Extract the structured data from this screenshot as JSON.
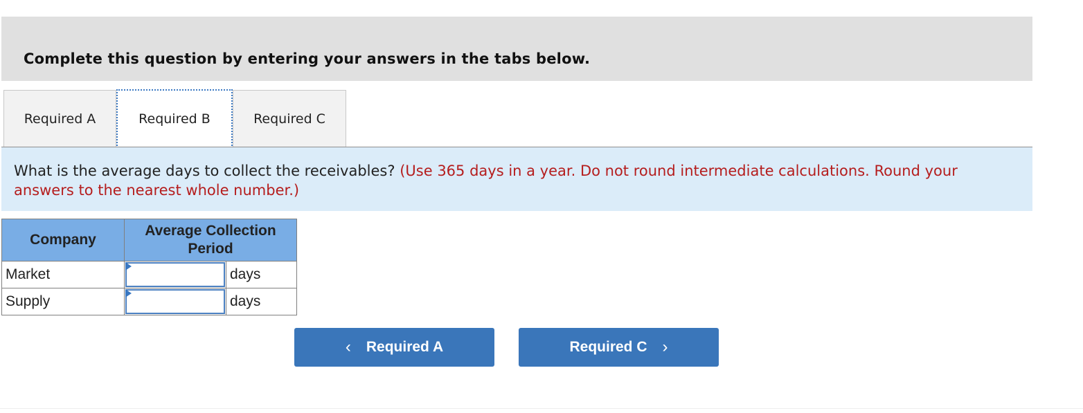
{
  "instruction": "Complete this question by entering your answers in the tabs below.",
  "tabs": [
    {
      "label": "Required A",
      "active": false
    },
    {
      "label": "Required B",
      "active": true
    },
    {
      "label": "Required C",
      "active": false
    }
  ],
  "question": {
    "text": "What is the average days to collect the receivables?",
    "note": "(Use 365 days in a year. Do not round intermediate calculations. Round your answers to the nearest whole number.)"
  },
  "table": {
    "headers": [
      "Company",
      "Average Collection Period"
    ],
    "rows": [
      {
        "company": "Market",
        "value": "",
        "unit": "days"
      },
      {
        "company": "Supply",
        "value": "",
        "unit": "days"
      }
    ]
  },
  "nav": {
    "prev_label": "Required A",
    "next_label": "Required C",
    "prev_icon": "chevron-left-icon",
    "next_icon": "chevron-right-icon"
  },
  "colors": {
    "accent": "#3a76ba",
    "header_bg": "#79ade5",
    "question_bg": "#dbecf9",
    "note_red": "#b51d1d"
  }
}
